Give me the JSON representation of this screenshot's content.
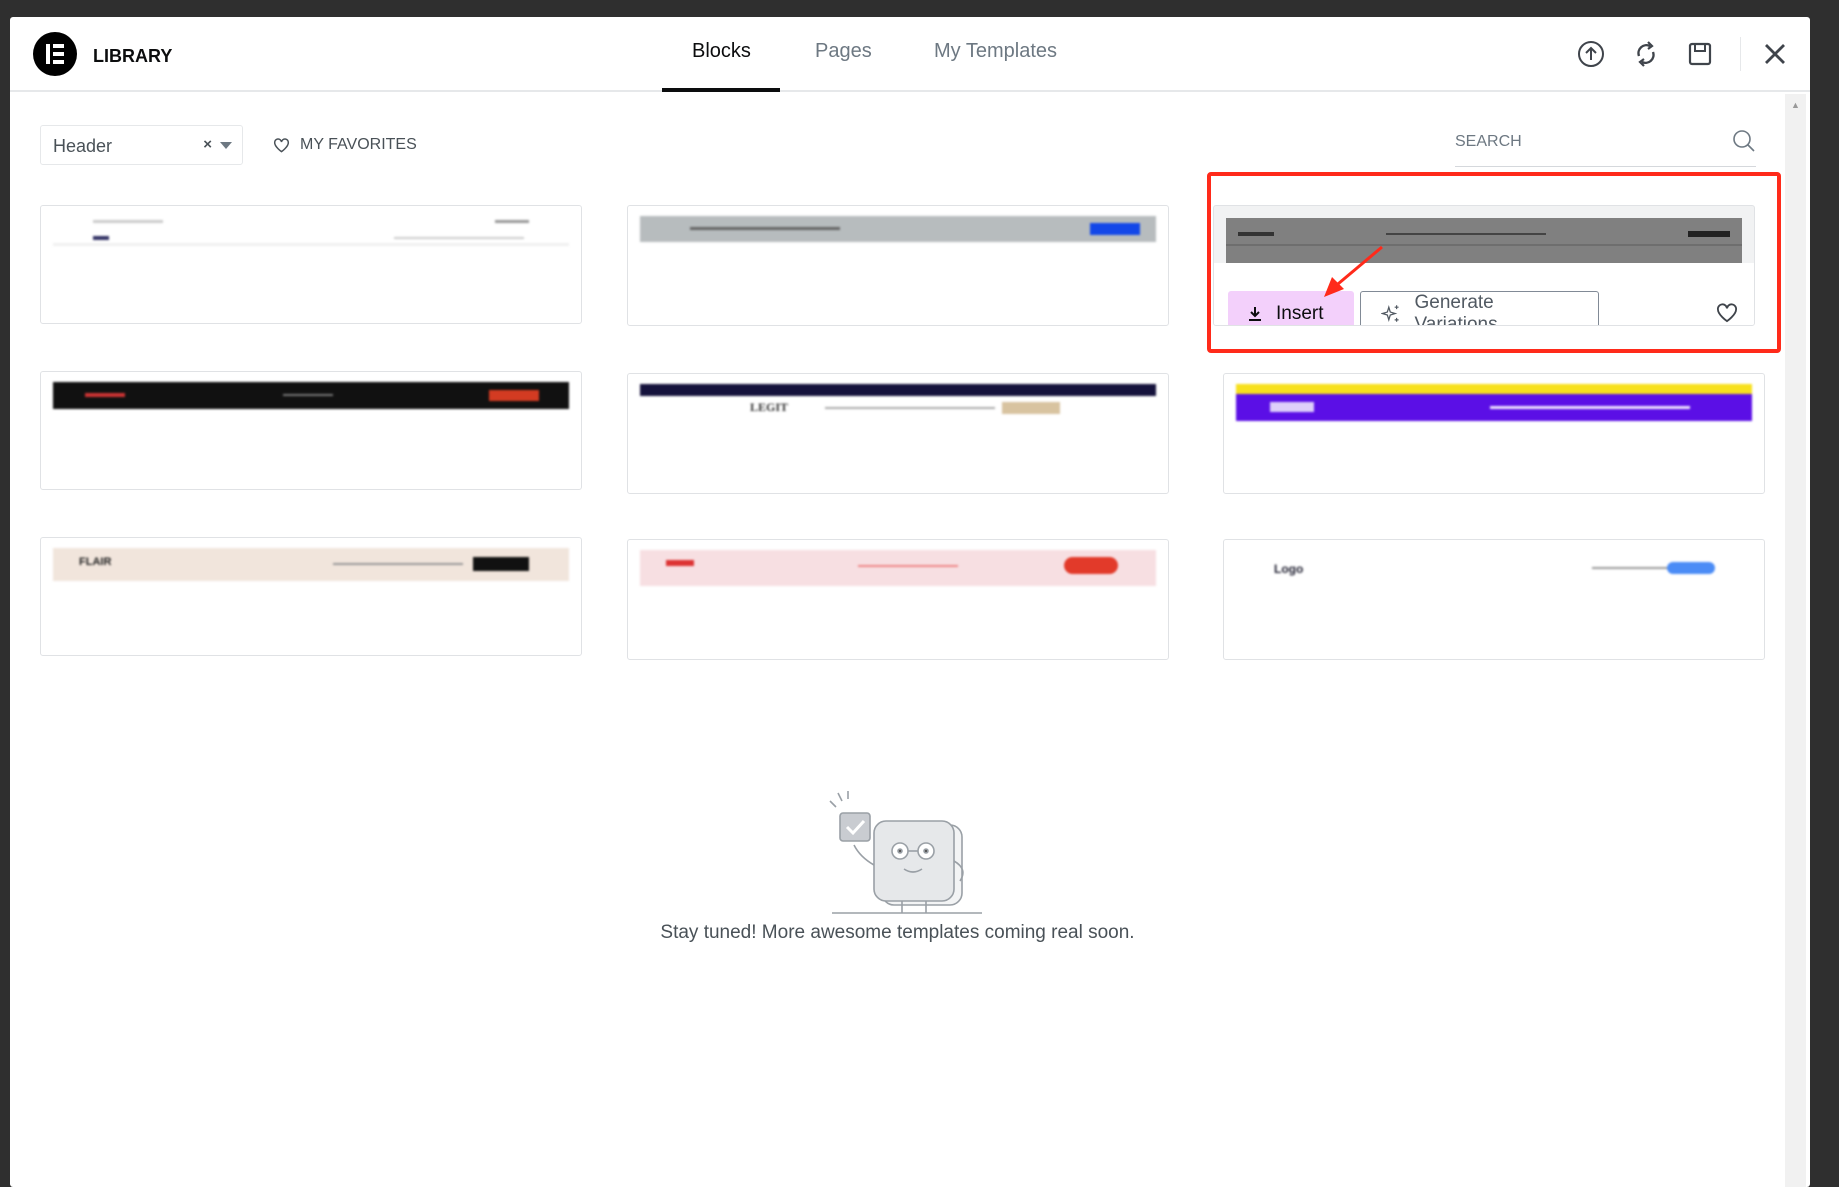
{
  "header": {
    "title": "LIBRARY",
    "tabs": [
      {
        "label": "Blocks",
        "active": true
      },
      {
        "label": "Pages"
      },
      {
        "label": "My Templates"
      }
    ],
    "icons": [
      "upload-icon",
      "sync-icon",
      "save-icon",
      "close-icon"
    ]
  },
  "filter": {
    "category": "Header",
    "favorites_label": "MY FAVORITES",
    "search_placeholder": "SEARCH"
  },
  "cards": [
    {
      "id": 1,
      "preview": "light"
    },
    {
      "id": 2,
      "preview": "gray-blue"
    },
    {
      "id": 3,
      "preview": "gray-dark",
      "hovered": true
    },
    {
      "id": 4,
      "preview": "black-red"
    },
    {
      "id": 5,
      "preview": "navy-legit",
      "brand": "LEGIT"
    },
    {
      "id": 6,
      "preview": "purple-yellow"
    },
    {
      "id": 7,
      "preview": "beige-flair",
      "brand": "FLAIR"
    },
    {
      "id": 8,
      "preview": "pink-red"
    },
    {
      "id": 9,
      "preview": "white-logo",
      "brand": "Logo"
    }
  ],
  "hover_actions": {
    "insert_label": "Insert",
    "generate_label": "Generate Variations"
  },
  "colors": {
    "insert_bg": "#f3d0fb",
    "highlight": "#ff2a1a",
    "accent": "#0c0d0e"
  },
  "empty_message": "Stay tuned! More awesome templates coming real soon."
}
